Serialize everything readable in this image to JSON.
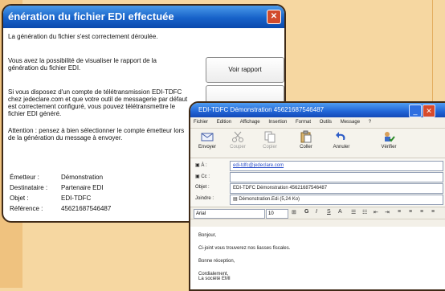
{
  "win1": {
    "title": "énération du fichier EDI effectuée",
    "text1": "La génération du fichier s'est correctement déroulée.",
    "text2": "Vous avez la possibilité de visualiser le rapport de la génération du fichier EDI.",
    "voir_btn": "Voir rapport",
    "text3": "Si vous disposez d'un compte de télétransmission EDI-TDFC chez jedeclare.com et que votre outil de messagerie par défaut est correctement configuré, vous pouvez télétransmettre le fichier EDI généré.",
    "text4": "Attention : pensez à bien sélectionner le compte émetteur lors de la génération du message à envoyer.",
    "info": [
      {
        "label": "Émetteur :",
        "value": "Démonstration"
      },
      {
        "label": "Destinataire :",
        "value": "Partenaire EDI"
      },
      {
        "label": "Objet :",
        "value": "EDI-TDFC"
      },
      {
        "label": "Référence :",
        "value": "45621687546487"
      }
    ]
  },
  "win2": {
    "title": "EDI-TDFC Démonstration 45621687546487",
    "menu": [
      "Fichier",
      "Edition",
      "Affichage",
      "Insertion",
      "Format",
      "Outils",
      "Message",
      "?"
    ],
    "toolbar": {
      "send": "Envoyer",
      "cut": "Couper",
      "copy": "Copier",
      "paste": "Coller",
      "undo": "Annuler",
      "check": "Vérifier"
    },
    "to_label": "À :",
    "to_value": "edi-tdfc@jedeclare.com",
    "cc_label": "Cc :",
    "cc_value": "",
    "subject_label": "Objet :",
    "subject_value": "EDI-TDFC Démonstration 45621687546487",
    "attach_label": "Joindre :",
    "attach_value": "Démonstration.Edi (5,24 Ko)",
    "font": "Arial",
    "size": "10",
    "body": [
      "Bonjour,",
      "Ci-joint vous trouverez nos liasses fiscales.",
      "Bonne réception,",
      "Cordialement,",
      "La société EMI"
    ]
  },
  "colors": {
    "xp_blue": "#1762c9",
    "bg": "#f6d7a1",
    "border_dark": "#3f2a17"
  }
}
